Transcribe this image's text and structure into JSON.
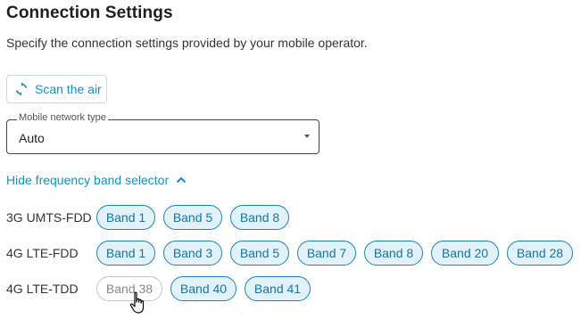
{
  "header": {
    "title": "Connection Settings",
    "subtitle": "Specify the connection settings provided by your mobile operator."
  },
  "scan_button": {
    "label": "Scan the air",
    "icon": "refresh-icon"
  },
  "network_type": {
    "legend": "Mobile network type",
    "value": "Auto"
  },
  "band_toggle": {
    "label": "Hide frequency band selector",
    "icon": "chevron-up-icon"
  },
  "band_rows": [
    {
      "label": "3G UMTS-FDD",
      "bands": [
        {
          "label": "Band 1",
          "selected": true
        },
        {
          "label": "Band 5",
          "selected": true
        },
        {
          "label": "Band 8",
          "selected": true
        }
      ]
    },
    {
      "label": "4G LTE-FDD",
      "bands": [
        {
          "label": "Band 1",
          "selected": true
        },
        {
          "label": "Band 3",
          "selected": true
        },
        {
          "label": "Band 5",
          "selected": true
        },
        {
          "label": "Band 7",
          "selected": true
        },
        {
          "label": "Band 8",
          "selected": true
        },
        {
          "label": "Band 20",
          "selected": true
        },
        {
          "label": "Band 28",
          "selected": true
        }
      ]
    },
    {
      "label": "4G LTE-TDD",
      "bands": [
        {
          "label": "Band 38",
          "selected": false
        },
        {
          "label": "Band 40",
          "selected": true
        },
        {
          "label": "Band 41",
          "selected": true
        }
      ]
    }
  ],
  "colors": {
    "accent": "#1790be",
    "chip_bg": "#e3f2f8",
    "chip_border": "#1a87b6"
  }
}
